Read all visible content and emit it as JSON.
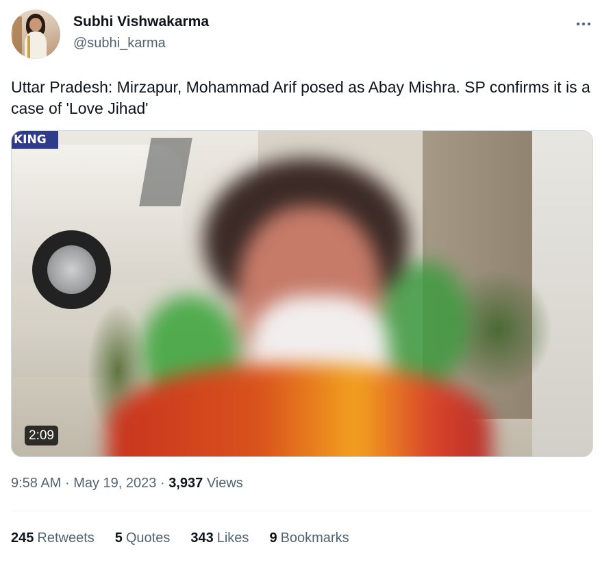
{
  "user": {
    "display_name": "Subhi Vishwakarma",
    "handle": "@subhi_karma"
  },
  "tweet": {
    "text": "Uttar Pradesh: Mirzapur, Mohammad Arif posed as Abay Mishra. SP confirms it is a case of 'Love Jihad'"
  },
  "media": {
    "duration": "2:09",
    "sign_text": "KING"
  },
  "meta": {
    "time": "9:58 AM",
    "separator": "·",
    "date": "May 19, 2023",
    "views_count": "3,937",
    "views_label": "Views"
  },
  "stats": {
    "retweets_count": "245",
    "retweets_label": "Retweets",
    "quotes_count": "5",
    "quotes_label": "Quotes",
    "likes_count": "343",
    "likes_label": "Likes",
    "bookmarks_count": "9",
    "bookmarks_label": "Bookmarks"
  },
  "icons": {
    "more": "more-dots-icon"
  }
}
